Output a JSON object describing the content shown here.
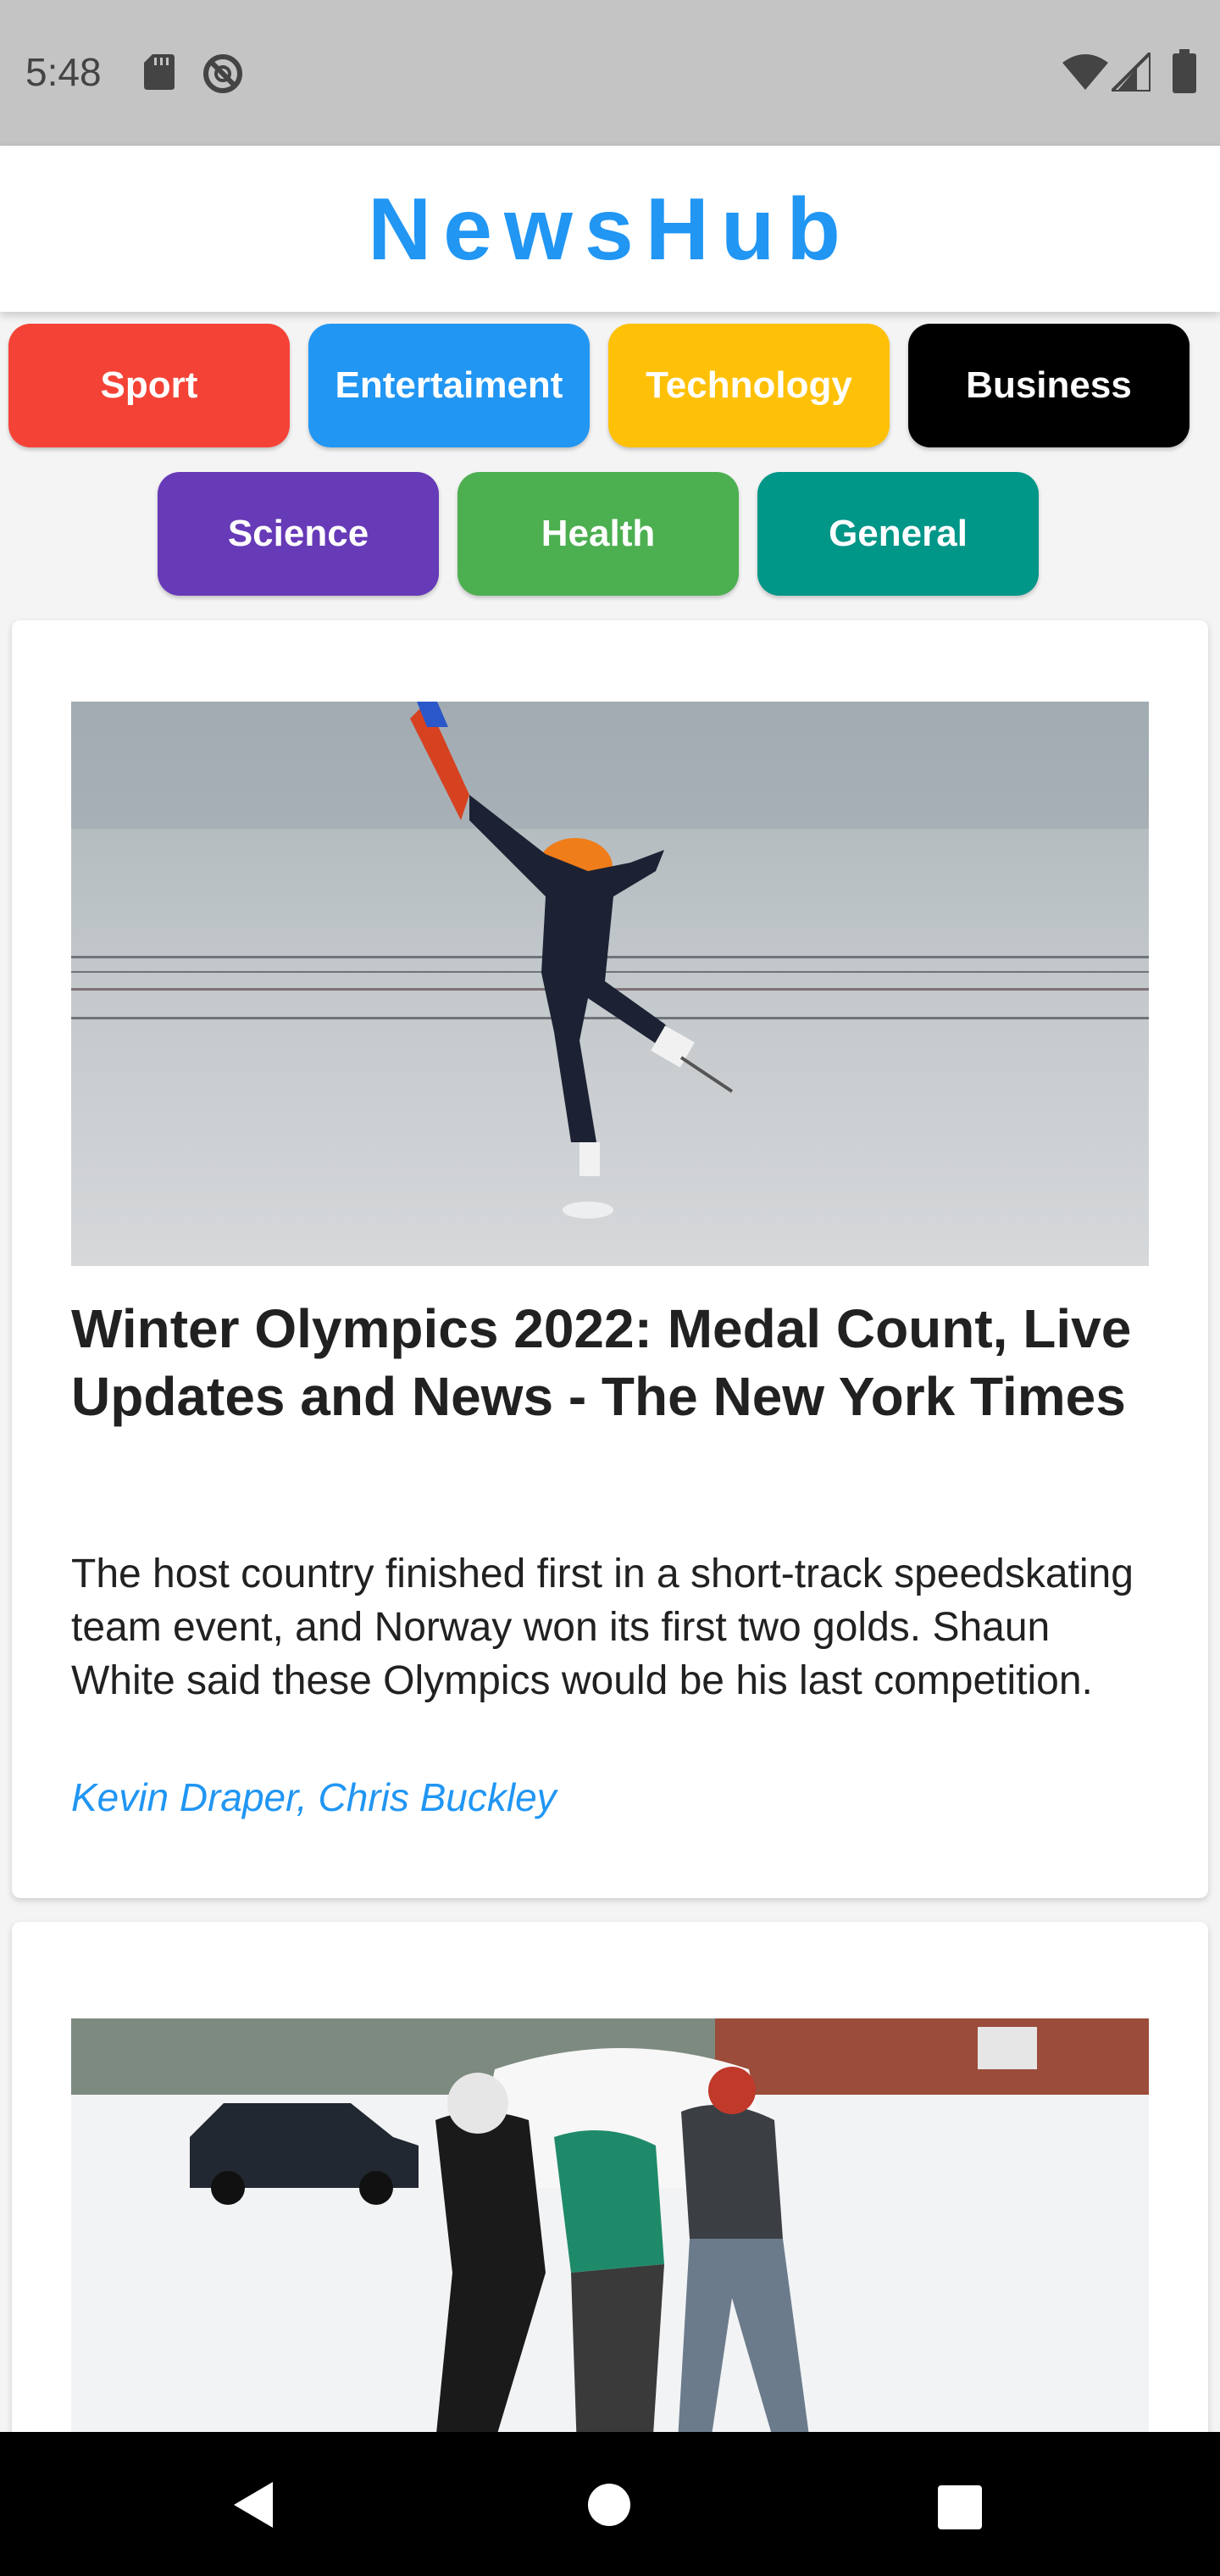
{
  "status_bar": {
    "time": "5:48",
    "icons": [
      "sd-card-icon",
      "do-not-disturb-icon",
      "wifi-icon",
      "signal-icon",
      "battery-icon"
    ]
  },
  "app": {
    "title": "NewsHub",
    "accent_color": "#2196f3"
  },
  "categories": [
    {
      "label": "Sport",
      "color": "#f44336"
    },
    {
      "label": "Entertaiment",
      "color": "#2196f3"
    },
    {
      "label": "Technology",
      "color": "#ffc107"
    },
    {
      "label": "Business",
      "color": "#000000"
    },
    {
      "label": "Science",
      "color": "#673ab7"
    },
    {
      "label": "Health",
      "color": "#4caf50"
    },
    {
      "label": "General",
      "color": "#009688"
    }
  ],
  "articles": [
    {
      "image": "speed-skater-photo",
      "title": "Winter Olympics 2022: Medal Count, Live Updates and News - The New York Times",
      "description": "The host country finished first in a short-track speedskating team event, and Norway won its first two golds. Shaun White said these Olympics would be his last competition.",
      "author": "Kevin Draper, Chris Buckley"
    },
    {
      "image": "people-pushing-car-in-snow-photo"
    }
  ],
  "nav_bar": {
    "icons": [
      "back-icon",
      "home-icon",
      "recents-icon"
    ]
  }
}
